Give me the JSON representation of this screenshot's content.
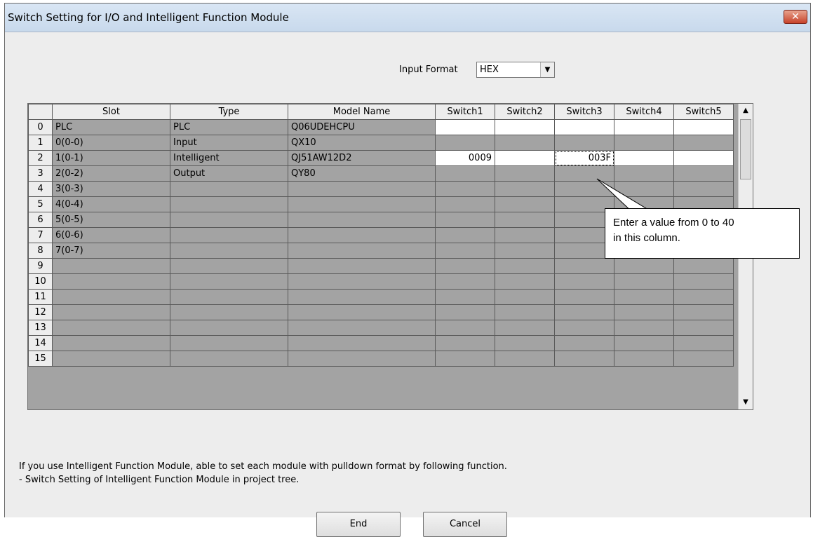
{
  "window": {
    "title": "Switch Setting for I/O and Intelligent Function Module",
    "close_label": "✕"
  },
  "input_format": {
    "label": "Input Format",
    "value": "HEX"
  },
  "grid": {
    "columns": [
      "",
      "Slot",
      "Type",
      "Model Name",
      "Switch1",
      "Switch2",
      "Switch3",
      "Switch4",
      "Switch5"
    ],
    "rows": [
      {
        "no": "0",
        "slot": "PLC",
        "type": "PLC",
        "model": "Q06UDEHCPU",
        "sw1": "",
        "sw2": "",
        "sw3": "",
        "sw4": "",
        "sw5": ""
      },
      {
        "no": "1",
        "slot": "0(0-0)",
        "type": "Input",
        "model": "QX10",
        "sw1": "",
        "sw2": "",
        "sw3": "",
        "sw4": "",
        "sw5": ""
      },
      {
        "no": "2",
        "slot": "1(0-1)",
        "type": "Intelligent",
        "model": "QJ51AW12D2",
        "sw1": "0009",
        "sw2": "",
        "sw3": "003F",
        "sw4": "",
        "sw5": ""
      },
      {
        "no": "3",
        "slot": "2(0-2)",
        "type": "Output",
        "model": "QY80",
        "sw1": "",
        "sw2": "",
        "sw3": "",
        "sw4": "",
        "sw5": ""
      },
      {
        "no": "4",
        "slot": "3(0-3)",
        "type": "",
        "model": "",
        "sw1": "",
        "sw2": "",
        "sw3": "",
        "sw4": "",
        "sw5": ""
      },
      {
        "no": "5",
        "slot": "4(0-4)",
        "type": "",
        "model": "",
        "sw1": "",
        "sw2": "",
        "sw3": "",
        "sw4": "",
        "sw5": ""
      },
      {
        "no": "6",
        "slot": "5(0-5)",
        "type": "",
        "model": "",
        "sw1": "",
        "sw2": "",
        "sw3": "",
        "sw4": "",
        "sw5": ""
      },
      {
        "no": "7",
        "slot": "6(0-6)",
        "type": "",
        "model": "",
        "sw1": "",
        "sw2": "",
        "sw3": "",
        "sw4": "",
        "sw5": ""
      },
      {
        "no": "8",
        "slot": "7(0-7)",
        "type": "",
        "model": "",
        "sw1": "",
        "sw2": "",
        "sw3": "",
        "sw4": "",
        "sw5": ""
      },
      {
        "no": "9",
        "slot": "",
        "type": "",
        "model": "",
        "sw1": "",
        "sw2": "",
        "sw3": "",
        "sw4": "",
        "sw5": ""
      },
      {
        "no": "10",
        "slot": "",
        "type": "",
        "model": "",
        "sw1": "",
        "sw2": "",
        "sw3": "",
        "sw4": "",
        "sw5": ""
      },
      {
        "no": "11",
        "slot": "",
        "type": "",
        "model": "",
        "sw1": "",
        "sw2": "",
        "sw3": "",
        "sw4": "",
        "sw5": ""
      },
      {
        "no": "12",
        "slot": "",
        "type": "",
        "model": "",
        "sw1": "",
        "sw2": "",
        "sw3": "",
        "sw4": "",
        "sw5": ""
      },
      {
        "no": "13",
        "slot": "",
        "type": "",
        "model": "",
        "sw1": "",
        "sw2": "",
        "sw3": "",
        "sw4": "",
        "sw5": ""
      },
      {
        "no": "14",
        "slot": "",
        "type": "",
        "model": "",
        "sw1": "",
        "sw2": "",
        "sw3": "",
        "sw4": "",
        "sw5": ""
      },
      {
        "no": "15",
        "slot": "",
        "type": "",
        "model": "",
        "sw1": "",
        "sw2": "",
        "sw3": "",
        "sw4": "",
        "sw5": ""
      }
    ]
  },
  "callout": {
    "line1": "Enter a value from 0 to 40",
    "line2": "in this column."
  },
  "note": {
    "line1": "If you use Intelligent Function Module, able to set each module with pulldown format by following function.",
    "line2": "- Switch Setting of Intelligent Function Module in project tree."
  },
  "buttons": {
    "end": "End",
    "cancel": "Cancel"
  },
  "icons": {
    "dropdown": "▼",
    "scroll_up": "▲",
    "scroll_down": "▼"
  }
}
